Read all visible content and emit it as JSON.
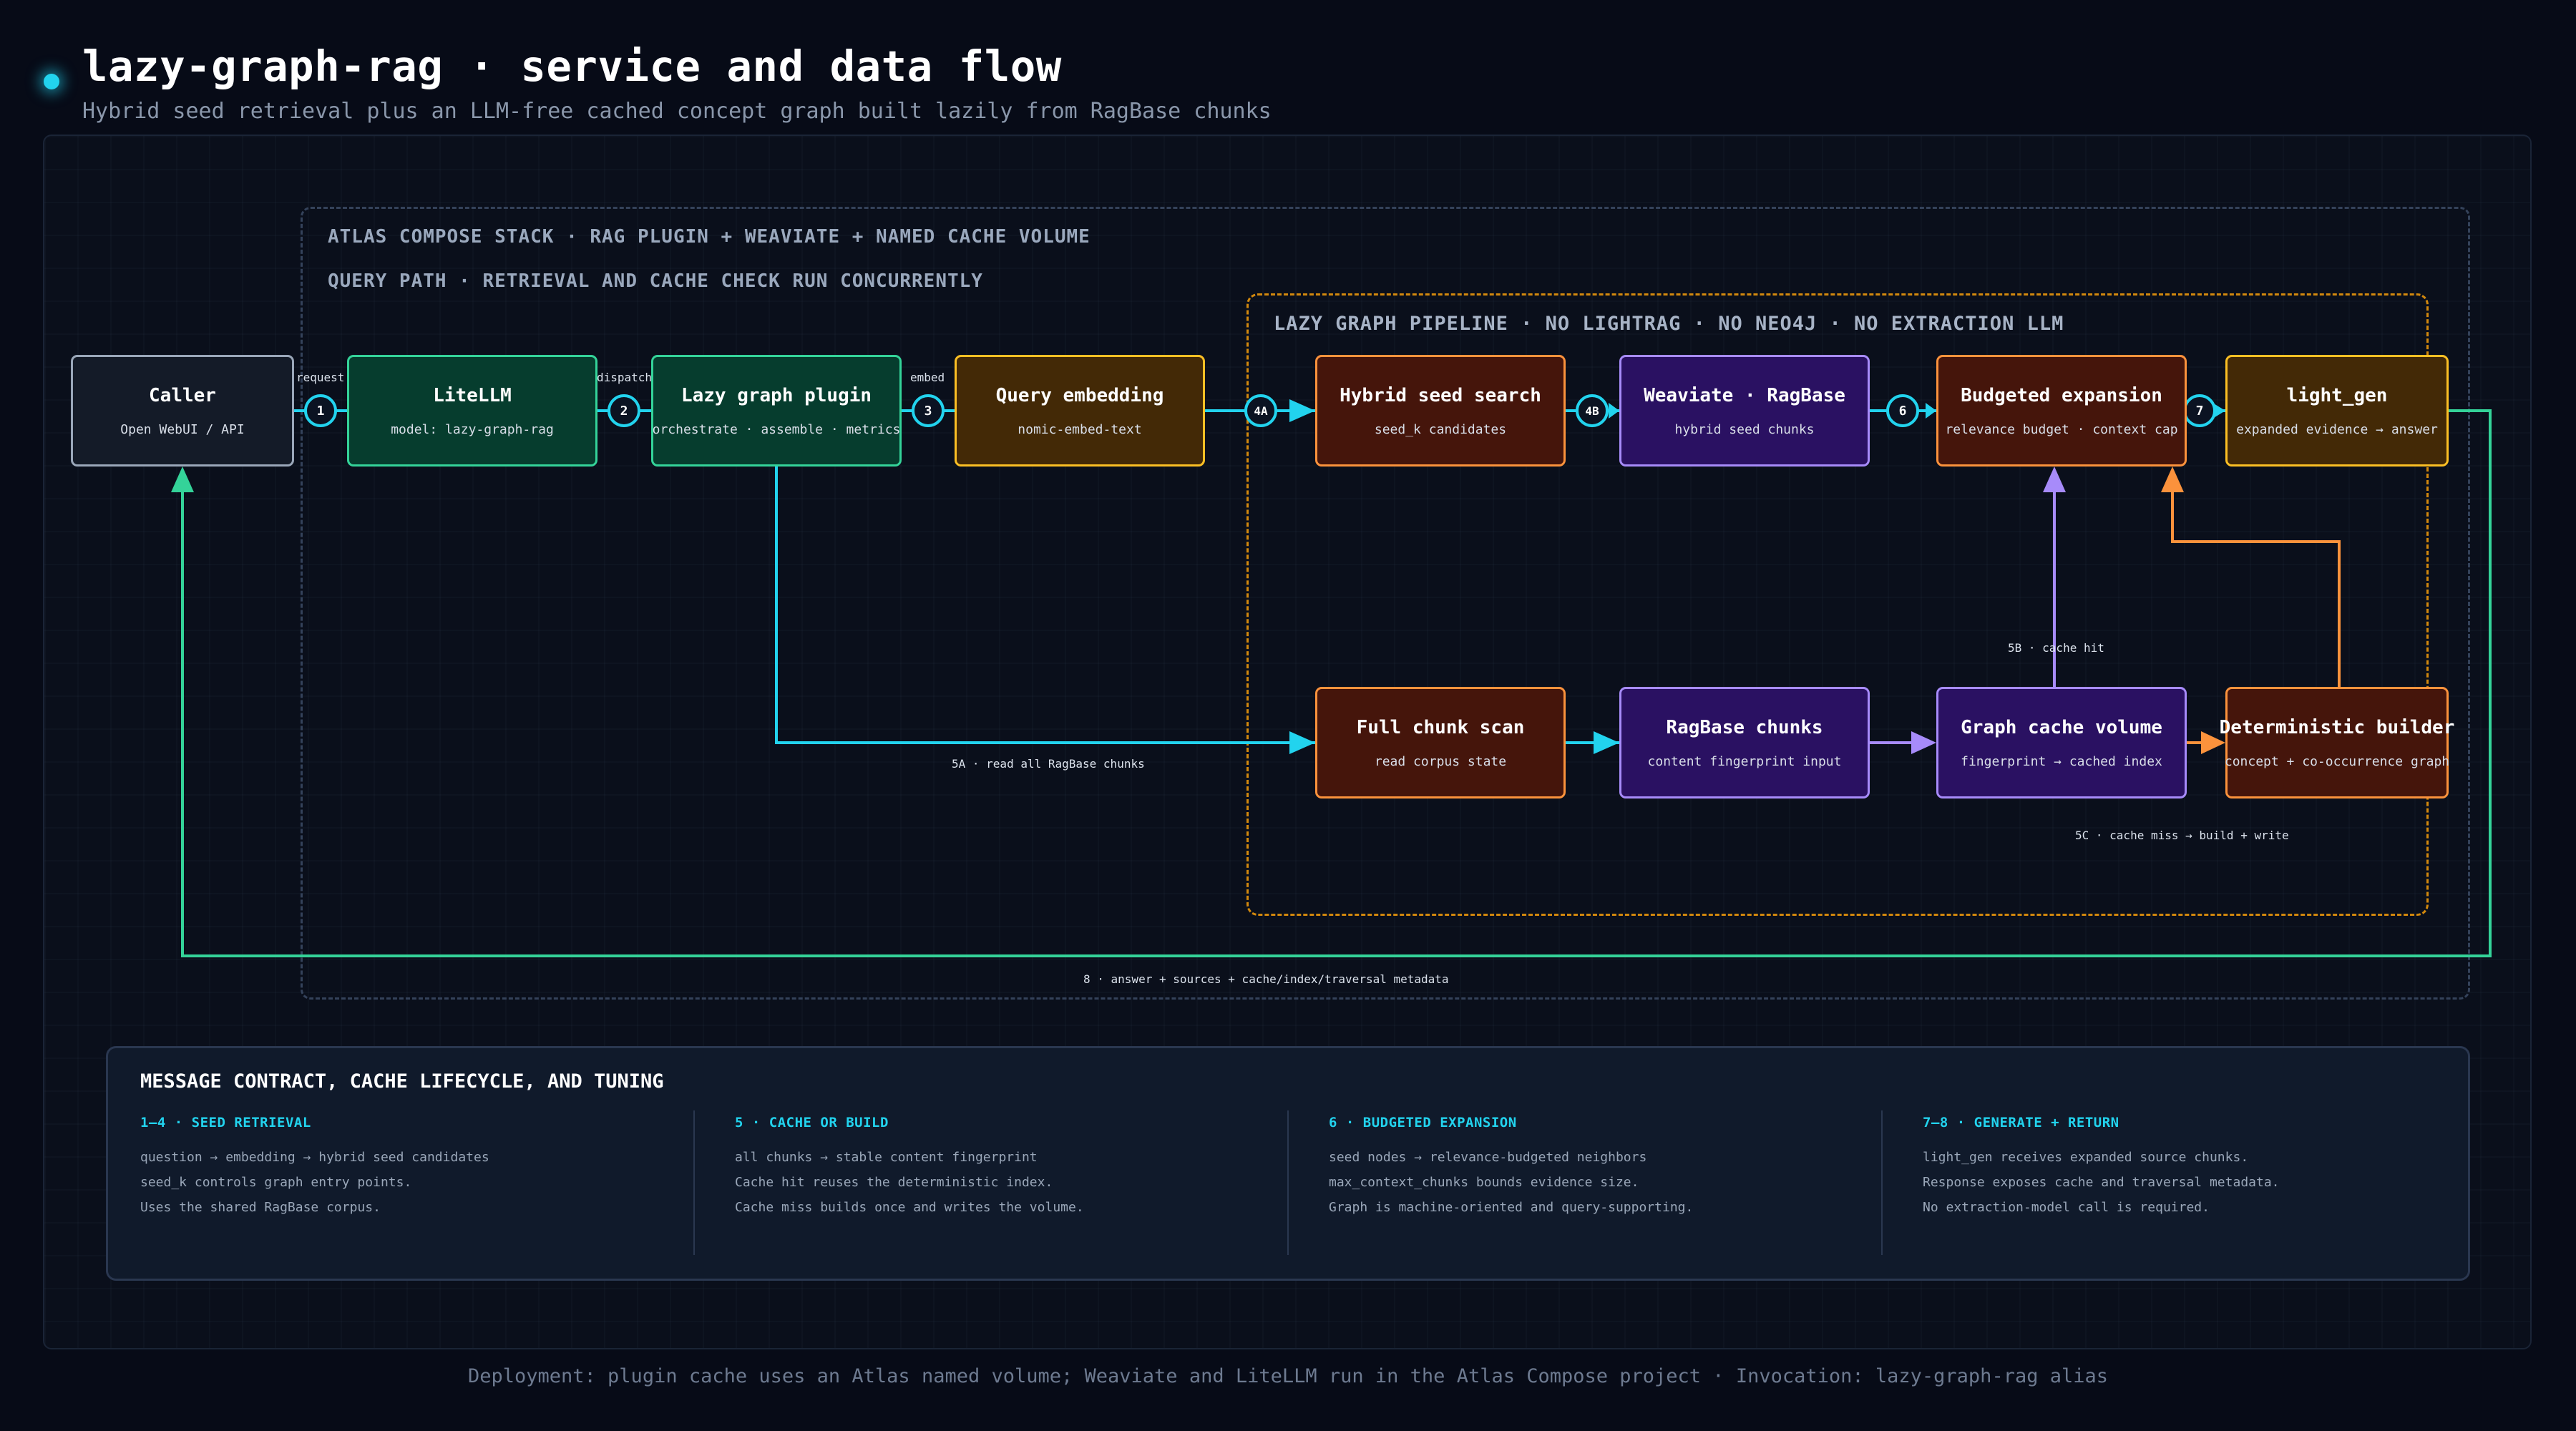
{
  "header": {
    "title": "lazy-graph-rag · service and data flow",
    "subtitle": "Hybrid seed retrieval plus an LLM-free cached concept graph built lazily from RagBase chunks"
  },
  "frames": {
    "stack_label": "ATLAS COMPOSE STACK · RAG PLUGIN + WEAVIATE + NAMED CACHE VOLUME",
    "query_label": "QUERY PATH · RETRIEVAL AND CACHE CHECK RUN CONCURRENTLY",
    "pipeline_label": "LAZY GRAPH PIPELINE · NO LIGHTRAG · NO NEO4J · NO EXTRACTION LLM"
  },
  "nodes": {
    "caller": {
      "title": "Caller",
      "sub": "Open WebUI / API"
    },
    "litellm": {
      "title": "LiteLLM",
      "sub": "model: lazy-graph-rag"
    },
    "plugin": {
      "title": "Lazy graph plugin",
      "sub": "orchestrate · assemble · metrics"
    },
    "embedding": {
      "title": "Query embedding",
      "sub": "nomic-embed-text"
    },
    "seed_search": {
      "title": "Hybrid seed search",
      "sub": "seed_k candidates"
    },
    "weaviate": {
      "title": "Weaviate · RagBase",
      "sub": "hybrid seed chunks"
    },
    "expansion": {
      "title": "Budgeted expansion",
      "sub": "relevance budget · context cap"
    },
    "light_gen": {
      "title": "light_gen",
      "sub": "expanded evidence → answer"
    },
    "chunk_scan": {
      "title": "Full chunk scan",
      "sub": "read corpus state"
    },
    "ragbase_chunks": {
      "title": "RagBase chunks",
      "sub": "content fingerprint input"
    },
    "cache_volume": {
      "title": "Graph cache volume",
      "sub": "fingerprint → cached index"
    },
    "builder": {
      "title": "Deterministic builder",
      "sub": "concept + co-occurrence graph"
    }
  },
  "edges": {
    "request": "request",
    "dispatch": "dispatch",
    "embed": "embed",
    "read_all": "5A · read all RagBase chunks",
    "cache_hit": "5B · cache hit",
    "cache_miss": "5C · cache miss → build + write",
    "return": "8 · answer + sources + cache/index/traversal metadata"
  },
  "steps": {
    "s1": "1",
    "s2": "2",
    "s3": "3",
    "s4a": "4A",
    "s4b": "4B",
    "s6": "6",
    "s7": "7"
  },
  "contract": {
    "title": "MESSAGE CONTRACT, CACHE LIFECYCLE, AND TUNING",
    "columns": [
      {
        "heading": "1–4 · SEED RETRIEVAL",
        "lines": [
          "question → embedding → hybrid seed candidates",
          "seed_k controls graph entry points.",
          "Uses the shared RagBase corpus."
        ]
      },
      {
        "heading": "5 · CACHE OR BUILD",
        "lines": [
          "all chunks → stable content fingerprint",
          "Cache hit reuses the deterministic index.",
          "Cache miss builds once and writes the volume."
        ]
      },
      {
        "heading": "6 · BUDGETED EXPANSION",
        "lines": [
          "seed nodes → relevance-budgeted neighbors",
          "max_context_chunks bounds evidence size.",
          "Graph is machine-oriented and query-supporting."
        ]
      },
      {
        "heading": "7–8 · GENERATE + RETURN",
        "lines": [
          "light_gen receives expanded source chunks.",
          "Response exposes cache and traversal metadata.",
          "No extraction-model call is required."
        ]
      }
    ]
  },
  "footer": "Deployment: plugin cache uses an Atlas named volume; Weaviate and LiteLLM run in the Atlas Compose project · Invocation: lazy-graph-rag alias",
  "colors": {
    "cyan": "#22d3ee",
    "green": "#34d399",
    "purple": "#a78bfa",
    "orange": "#fb923c",
    "amber": "#fbbf24"
  }
}
